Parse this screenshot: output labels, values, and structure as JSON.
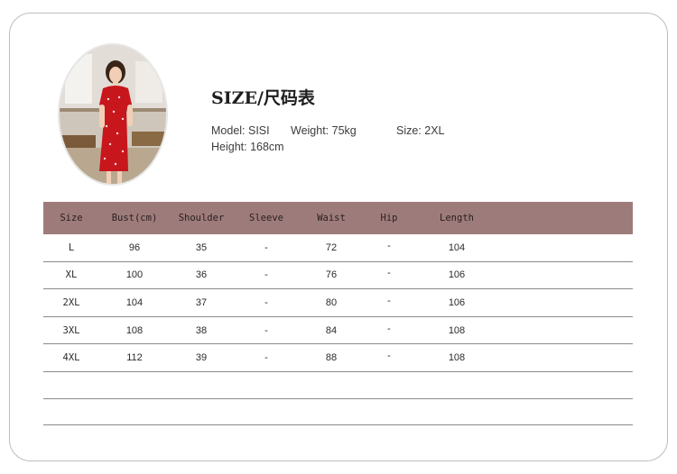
{
  "title": "SIZE/尺码表",
  "model_info": {
    "model": "Model:  SISI",
    "weight": "Weight:  75kg",
    "size": "Size:  2XL",
    "height": "Height:  168cm"
  },
  "table": {
    "headers": [
      "Size",
      "Bust(cm)",
      "Shoulder",
      "Sleeve",
      "Waist",
      "Hip",
      "Length"
    ],
    "rows": [
      [
        "L",
        "96",
        "35",
        "-",
        "72",
        "-",
        "104"
      ],
      [
        "XL",
        "100",
        "36",
        "-",
        "76",
        "-",
        "106"
      ],
      [
        "2XL",
        "104",
        "37",
        "-",
        "80",
        "-",
        "106"
      ],
      [
        "3XL",
        "108",
        "38",
        "-",
        "84",
        "-",
        "108"
      ],
      [
        "4XL",
        "112",
        "39",
        "-",
        "88",
        "-",
        "108"
      ]
    ]
  },
  "colors": {
    "header_bg": "#9e7b7b",
    "dress_red": "#c8161d"
  },
  "icons": {
    "photo": "model-photo"
  }
}
